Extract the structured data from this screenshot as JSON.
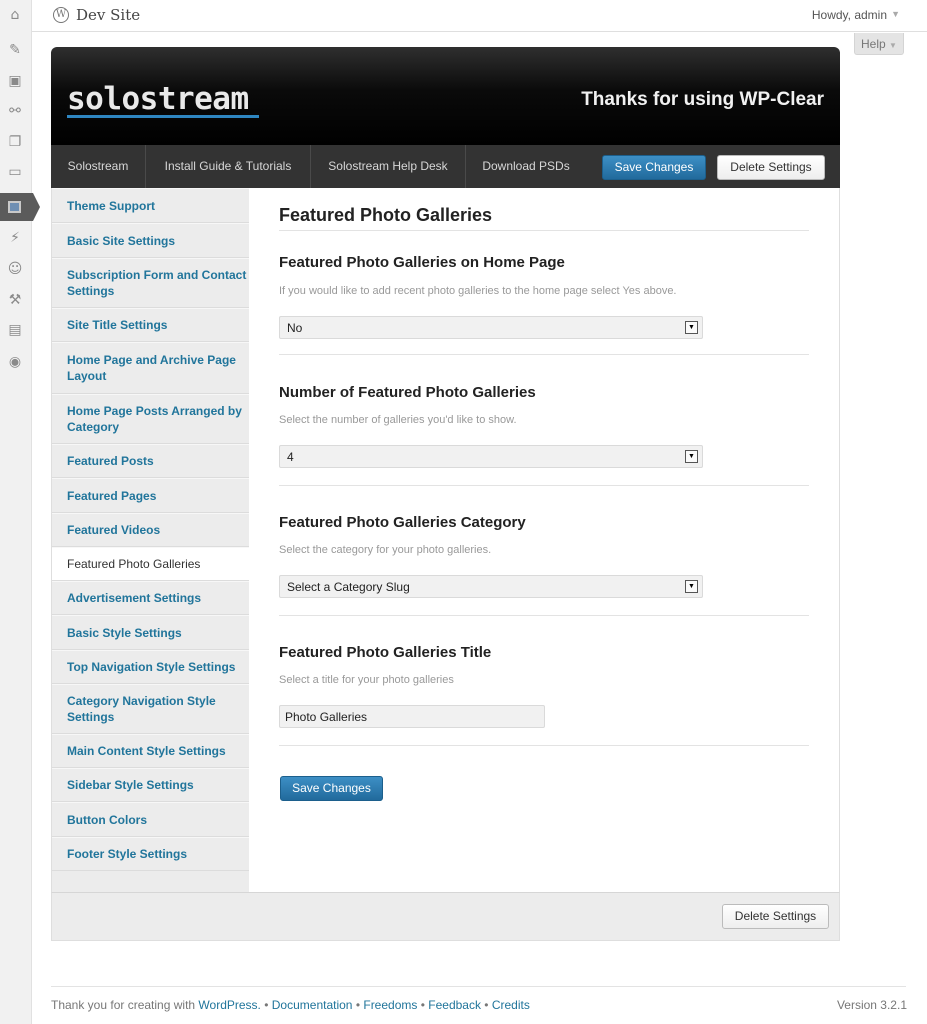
{
  "topbar": {
    "site_name": "Dev Site",
    "howdy": "Howdy, admin",
    "help_label": "Help"
  },
  "admin_menu_icons": [
    "dashboard-icon",
    "posts-icon",
    "media-icon",
    "links-icon",
    "pages-icon",
    "comments-icon",
    "appearance-icon",
    "plugins-icon",
    "users-icon",
    "tools-icon",
    "settings-icon",
    "collapse-icon"
  ],
  "banner": {
    "logo": "solostream",
    "tagline": "Thanks for using WP-Clear"
  },
  "nav": {
    "links": [
      "Solostream",
      "Install Guide & Tutorials",
      "Solostream Help Desk",
      "Download PSDs"
    ],
    "save_label": "Save Changes",
    "delete_label": "Delete Settings"
  },
  "sidebar": {
    "items": [
      "Theme Support",
      "Basic Site Settings",
      "Subscription Form and Contact Settings",
      "Site Title Settings",
      "Home Page and Archive Page Layout",
      "Home Page Posts Arranged by Category",
      "Featured Posts",
      "Featured Pages",
      "Featured Videos",
      "Featured Photo Galleries",
      "Advertisement Settings",
      "Basic Style Settings",
      "Top Navigation Style Settings",
      "Category Navigation Style Settings",
      "Main Content Style Settings",
      "Sidebar Style Settings",
      "Button Colors",
      "Footer Style Settings"
    ],
    "active": "Featured Photo Galleries"
  },
  "main": {
    "title": "Featured Photo Galleries",
    "sections": [
      {
        "title": "Featured Photo Galleries on Home Page",
        "desc": "If you would like to add recent photo galleries to the home page select Yes above.",
        "value": "No"
      },
      {
        "title": "Number of Featured Photo Galleries",
        "desc": "Select the number of galleries you'd like to show.",
        "value": "4"
      },
      {
        "title": "Featured Photo Galleries Category",
        "desc": "Select the category for your photo galleries.",
        "value": "Select a Category Slug"
      },
      {
        "title": "Featured Photo Galleries Title",
        "desc": "Select a title for your photo galleries",
        "value": "Photo Galleries"
      }
    ],
    "save_label": "Save Changes"
  },
  "footer_panel": {
    "delete_label": "Delete Settings"
  },
  "wp_footer": {
    "thanks": "Thank you for creating with",
    "wordpress": "WordPress.",
    "links": [
      "Documentation",
      "Freedoms",
      "Feedback",
      "Credits"
    ],
    "version": "Version 3.2.1"
  }
}
